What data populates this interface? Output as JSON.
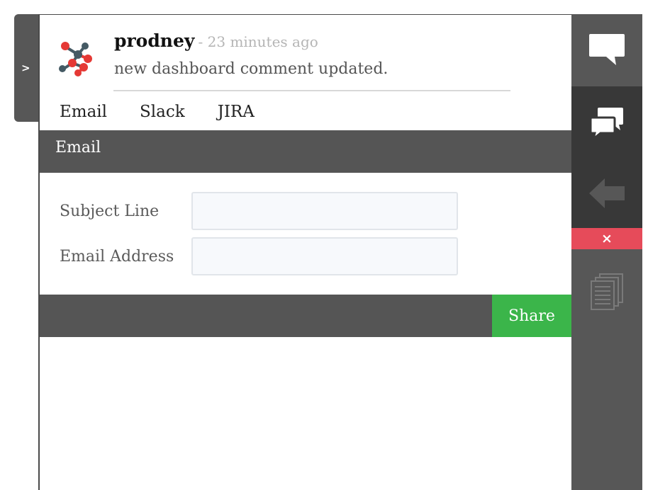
{
  "sidebar_toggle": {
    "label": ">"
  },
  "comment": {
    "username": "prodney",
    "time_ago": "- 23 minutes ago",
    "text": "new dashboard comment updated."
  },
  "share_tabs": [
    {
      "label": "Email"
    },
    {
      "label": "Slack"
    },
    {
      "label": "JIRA"
    }
  ],
  "section": {
    "title": "Email"
  },
  "form": {
    "subject_label": "Subject Line",
    "subject_value": "",
    "email_label": "Email Address",
    "email_value": ""
  },
  "actions": {
    "share_label": "Share"
  },
  "right_sidebar": {
    "icons": [
      "comment-icon",
      "discussion-icon",
      "back-arrow-icon",
      "close-icon",
      "documents-icon"
    ],
    "close_label": "×"
  },
  "colors": {
    "dark_bar": "#555555",
    "sidebar_active": "#383838",
    "share_green": "#3bb54a",
    "close_red": "#e64b5a",
    "logo_red": "#e53935",
    "logo_slate": "#455a64"
  }
}
